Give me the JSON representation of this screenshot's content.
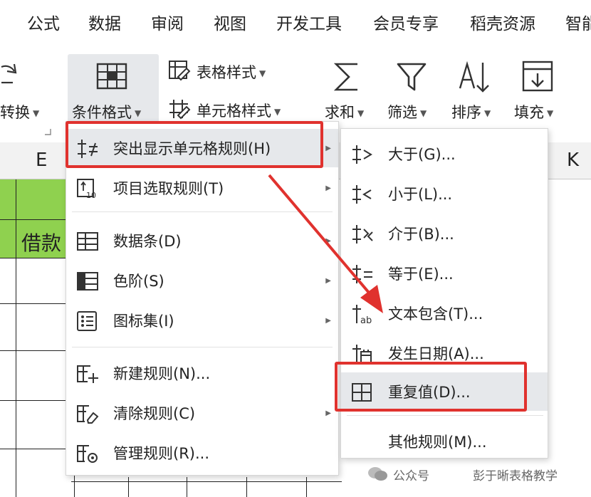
{
  "tabs": [
    "公式",
    "数据",
    "审阅",
    "视图",
    "开发工具",
    "会员专享",
    "稻壳资源",
    "智能"
  ],
  "ribbon": {
    "convert": "转换",
    "cond_format": "条件格式",
    "table_style": "表格样式",
    "cell_style": "单元格样式",
    "sum": "求和",
    "filter": "筛选",
    "sort": "排序",
    "fill": "填充"
  },
  "sheet": {
    "col_e": "E",
    "col_k": "K",
    "header_cell": "借款"
  },
  "menu_main": [
    "突出显示单元格规则(H)",
    "项目选取规则(T)",
    "数据条(D)",
    "色阶(S)",
    "图标集(I)",
    "新建规则(N)...",
    "清除规则(C)",
    "管理规则(R)..."
  ],
  "menu_sub": [
    "大于(G)...",
    "小于(L)...",
    "介于(B)...",
    "等于(E)...",
    "文本包含(T)...",
    "发生日期(A)...",
    "重复值(D)...",
    "其他规则(M)..."
  ],
  "watermark": {
    "left": "公众号",
    "right": "彭于晰表格教学"
  },
  "colors": {
    "green": "#8fd14f",
    "red": "#e0322e",
    "highlight": "#e6e8eb"
  }
}
